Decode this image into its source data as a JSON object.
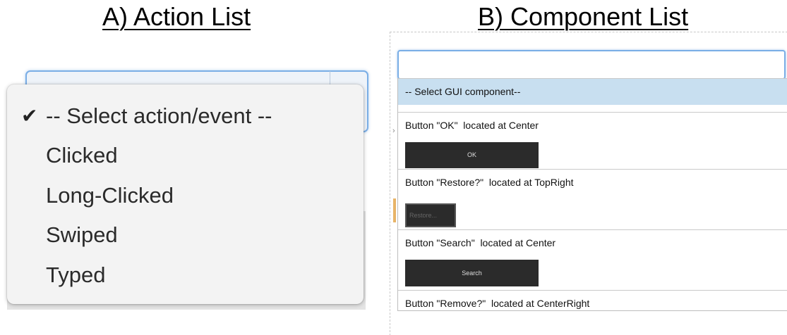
{
  "panels": {
    "a": {
      "title": "A) Action List",
      "menu": {
        "checkmark": "✔",
        "items": [
          {
            "label": "-- Select action/event --",
            "checked": true
          },
          {
            "label": "Clicked",
            "checked": false
          },
          {
            "label": "Long-Clicked",
            "checked": false
          },
          {
            "label": "Swiped",
            "checked": false
          },
          {
            "label": "Typed",
            "checked": false
          }
        ]
      }
    },
    "b": {
      "title": "B) Component List",
      "search": {
        "value": "",
        "placeholder": ""
      },
      "list": {
        "placeholder_option": "-- Select GUI component--",
        "rows": [
          {
            "label": "Button \"OK\"  located at Center",
            "button_text": "OK"
          },
          {
            "label": "Button \"Restore?\"  located at TopRight",
            "button_text": "Restore..."
          },
          {
            "label": "Button \"Search\"  located at Center",
            "button_text": "Search"
          },
          {
            "label": "Button \"Remove?\"  located at CenterRight",
            "button_text": ""
          }
        ]
      }
    }
  },
  "colors": {
    "selected_row": "#c8dff0",
    "focus_border": "#7aaee6",
    "preview_button": "#2b2b2b"
  }
}
